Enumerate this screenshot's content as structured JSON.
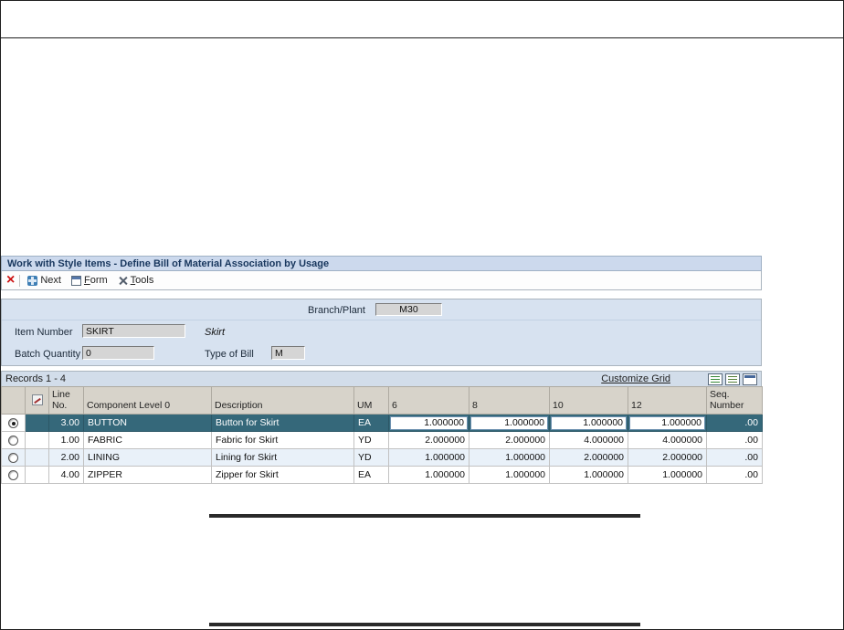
{
  "window": {
    "title": "Work with Style Items - Define Bill of Material Association by Usage"
  },
  "toolbar": {
    "close_glyph": "×",
    "next_label": "Next",
    "form_label": "Form",
    "tools_label": "Tools"
  },
  "form": {
    "branch_plant": {
      "label": "Branch/Plant",
      "value": "M30"
    },
    "item_number": {
      "label": "Item Number",
      "value": "SKIRT",
      "description": "Skirt"
    },
    "batch_quantity": {
      "label": "Batch Quantity",
      "value": "0"
    },
    "type_of_bill": {
      "label": "Type of Bill",
      "value": "M"
    }
  },
  "grid": {
    "records_label": "Records 1 - 4",
    "customize_label": "Customize Grid",
    "headers": {
      "line_no": "Line No.",
      "component": "Component Level 0",
      "description": "Description",
      "um": "UM",
      "size6": "6",
      "size8": "8",
      "size10": "10",
      "size12": "12",
      "seq": "Seq. Number"
    },
    "rows": [
      {
        "selected": true,
        "line_no": "3.00",
        "component": "BUTTON",
        "description": "Button for Skirt",
        "um": "EA",
        "size6": "1.000000",
        "size8": "1.000000",
        "size10": "1.000000",
        "size12": "1.000000",
        "seq": ".00"
      },
      {
        "selected": false,
        "line_no": "1.00",
        "component": "FABRIC",
        "description": "Fabric for Skirt",
        "um": "YD",
        "size6": "2.000000",
        "size8": "2.000000",
        "size10": "4.000000",
        "size12": "4.000000",
        "seq": ".00"
      },
      {
        "selected": false,
        "line_no": "2.00",
        "component": "LINING",
        "description": "Lining for Skirt",
        "um": "YD",
        "size6": "1.000000",
        "size8": "1.000000",
        "size10": "2.000000",
        "size12": "2.000000",
        "seq": ".00"
      },
      {
        "selected": false,
        "line_no": "4.00",
        "component": "ZIPPER",
        "description": "Zipper for Skirt",
        "um": "EA",
        "size6": "1.000000",
        "size8": "1.000000",
        "size10": "1.000000",
        "size12": "1.000000",
        "seq": ".00"
      }
    ]
  },
  "icons": {
    "close": "×",
    "next": "css-shape",
    "form": "css-shape",
    "tools": "css-shape",
    "edit_pencil": "css-shape",
    "exports": [
      "excel-export-icon",
      "csv-export-icon",
      "expand-grid-icon"
    ]
  },
  "colors": {
    "selected_row_bg": "#35687a",
    "titlebar_bg": "#ccd9ed",
    "form_bg": "#d7e2f0",
    "grid_header_bg": "#d7d3ca"
  }
}
